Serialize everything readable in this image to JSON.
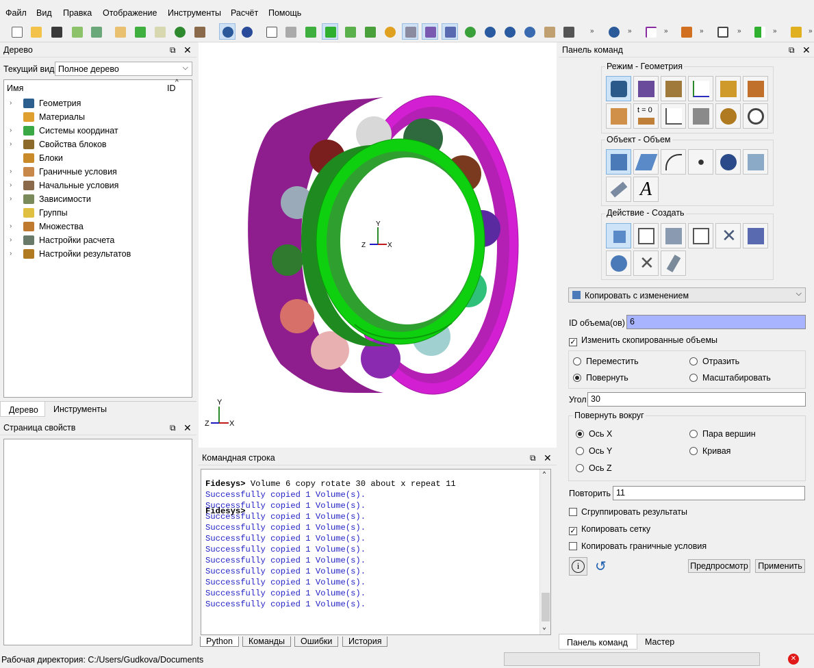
{
  "menu": [
    "Файл",
    "Вид",
    "Правка",
    "Отображение",
    "Инструменты",
    "Расчёт",
    "Помощь"
  ],
  "tree_panel": {
    "title": "Дерево",
    "current_view_label": "Текущий вид",
    "current_view_value": "Полное дерево",
    "col_name": "Имя",
    "col_id": "ID",
    "items": [
      {
        "label": "Геометрия",
        "icon": "geometry-icon",
        "color": "#2c5f8e",
        "expand": true
      },
      {
        "label": "Материалы",
        "icon": "materials-icon",
        "color": "#e0a030",
        "expand": false
      },
      {
        "label": "Системы координат",
        "icon": "coordinate-system-icon",
        "color": "#39a845",
        "expand": true
      },
      {
        "label": "Свойства блоков",
        "icon": "block-properties-icon",
        "color": "#8b6a2b",
        "expand": true
      },
      {
        "label": "Блоки",
        "icon": "blocks-icon",
        "color": "#c98a2a",
        "expand": false
      },
      {
        "label": "Граничные условия",
        "icon": "boundary-conditions-icon",
        "color": "#c8884a",
        "expand": true
      },
      {
        "label": "Начальные условия",
        "icon": "initial-conditions-icon",
        "color": "#8a6a4a",
        "expand": true
      },
      {
        "label": "Зависимости",
        "icon": "dependencies-icon",
        "color": "#7a8a5a",
        "expand": true
      },
      {
        "label": "Группы",
        "icon": "groups-icon",
        "color": "#e0c040",
        "expand": false
      },
      {
        "label": "Множества",
        "icon": "sets-icon",
        "color": "#c07a30",
        "expand": true
      },
      {
        "label": "Настройки расчета",
        "icon": "calc-settings-icon",
        "color": "#6a7a6a",
        "expand": true
      },
      {
        "label": "Настройки результатов",
        "icon": "results-settings-icon",
        "color": "#b07a20",
        "expand": true
      }
    ],
    "tabs": [
      "Дерево",
      "Инструменты"
    ]
  },
  "properties_panel": {
    "title": "Страница свойств"
  },
  "viewport": {
    "axis_x": "X",
    "axis_y": "Y",
    "axis_z": "Z"
  },
  "console": {
    "title": "Командная строка",
    "prompt": "Fidesys>",
    "command": " Volume 6 copy rotate 30 about x repeat 11",
    "lines": [
      "Successfully copied 1 Volume(s).",
      "Successfully copied 1 Volume(s).",
      "Successfully copied 1 Volume(s).",
      "Successfully copied 1 Volume(s).",
      "Successfully copied 1 Volume(s).",
      "Successfully copied 1 Volume(s).",
      "Successfully copied 1 Volume(s).",
      "Successfully copied 1 Volume(s).",
      "Successfully copied 1 Volume(s).",
      "Successfully copied 1 Volume(s).",
      "Successfully copied 1 Volume(s)."
    ],
    "tabs": [
      "Python",
      "Команды",
      "Ошибки",
      "История"
    ]
  },
  "command_panel": {
    "title": "Панель команд",
    "mode_title": "Режим - Геометрия",
    "object_title": "Объект - Объем",
    "action_title": "Действие - Создать",
    "operation": "Копировать с изменением",
    "volume_ids_label": "ID объема(ов)",
    "volume_ids_value": "6",
    "modify_copied_label": "Изменить скопированные объемы",
    "move_label": "Переместить",
    "reflect_label": "Отразить",
    "rotate_label": "Повернуть",
    "scale_label": "Масштабировать",
    "angle_label": "Угол",
    "angle_value": "30",
    "rotate_about_title": "Повернуть вокруг",
    "axis_x_label": "Ось X",
    "axis_y_label": "Ось Y",
    "axis_z_label": "Ось Z",
    "vertex_pair_label": "Пара вершин",
    "curve_label": "Кривая",
    "repeat_label": "Повторить",
    "repeat_value": "11",
    "group_results_label": "Сгруппировать результаты",
    "copy_mesh_label": "Копировать сетку",
    "copy_bc_label": "Копировать граничные условия",
    "preview_label": "Предпросмотр",
    "apply_label": "Применить",
    "tabs": [
      "Панель команд",
      "Мастер"
    ]
  },
  "status": {
    "working_dir": "Рабочая директория: C:/Users/Gudkova/Documents"
  }
}
